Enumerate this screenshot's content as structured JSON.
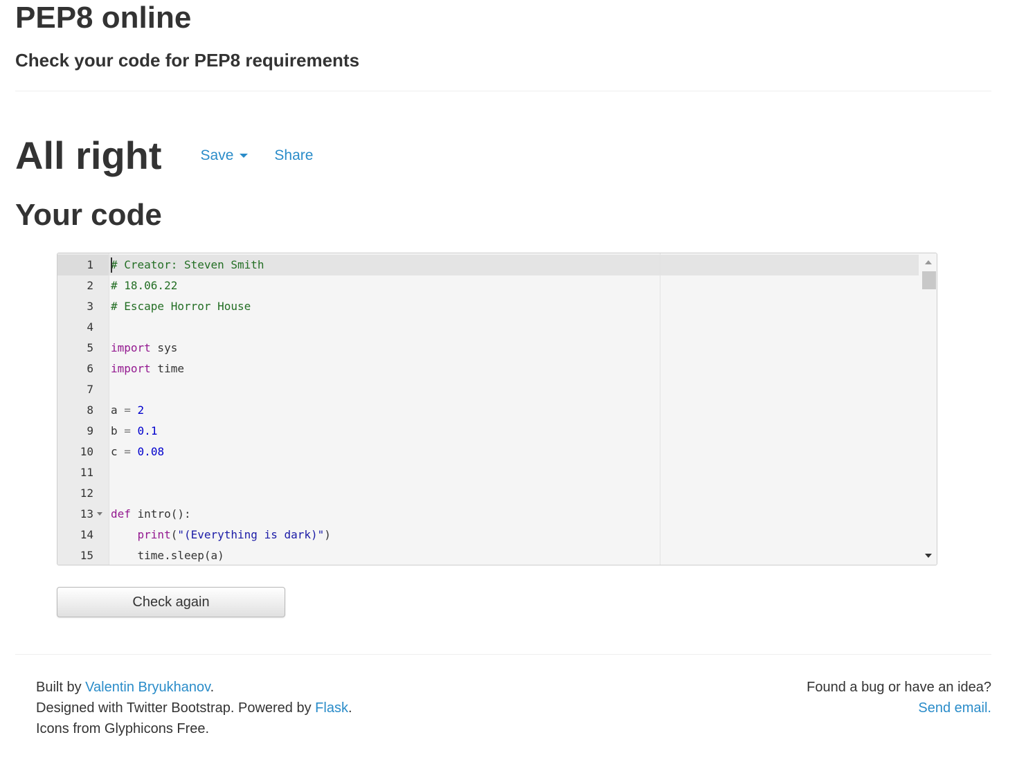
{
  "header": {
    "title": "PEP8 online",
    "subtitle": "Check your code for PEP8 requirements"
  },
  "result": {
    "status": "All right",
    "save_label": "Save",
    "share_label": "Share"
  },
  "code_section": {
    "heading": "Your code"
  },
  "editor": {
    "lines": [
      {
        "n": "1",
        "text": "# Creator: Steven Smith"
      },
      {
        "n": "2",
        "text": "# 18.06.22"
      },
      {
        "n": "3",
        "text": "# Escape Horror House"
      },
      {
        "n": "4",
        "text": ""
      },
      {
        "n": "5",
        "text": "import sys"
      },
      {
        "n": "6",
        "text": "import time"
      },
      {
        "n": "7",
        "text": ""
      },
      {
        "n": "8",
        "text": "a = 2"
      },
      {
        "n": "9",
        "text": "b = 0.1"
      },
      {
        "n": "10",
        "text": "c = 0.08"
      },
      {
        "n": "11",
        "text": ""
      },
      {
        "n": "12",
        "text": ""
      },
      {
        "n": "13",
        "text": "def intro():"
      },
      {
        "n": "14",
        "text": "    print(\"(Everything is dark)\")"
      },
      {
        "n": "15",
        "text": "    time.sleep(a)"
      }
    ]
  },
  "actions": {
    "check_again_label": "Check again"
  },
  "footer": {
    "built_by_prefix": "Built by ",
    "author": "Valentin Bryukhanov",
    "built_by_suffix": ".",
    "designed_prefix": "Designed with Twitter Bootstrap. Powered by ",
    "framework": "Flask",
    "designed_suffix": ".",
    "icons_text": "Icons from Glyphicons Free.",
    "bug_text": "Found a bug or have an idea?",
    "send_email": "Send email."
  },
  "colors": {
    "link": "#2a8cc9",
    "comment": "#236e24",
    "keyword": "#93188f",
    "number": "#0000cd"
  }
}
